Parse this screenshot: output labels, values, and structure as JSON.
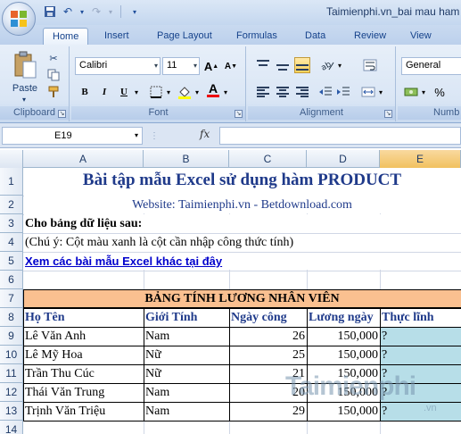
{
  "window": {
    "title": "Taimienphi.vn_bai mau ham"
  },
  "tabs": [
    "Home",
    "Insert",
    "Page Layout",
    "Formulas",
    "Data",
    "Review",
    "View"
  ],
  "ribbon": {
    "clipboard": {
      "paste_label": "Paste",
      "group_label": "Clipboard"
    },
    "font": {
      "font_name": "Calibri",
      "font_size": "11",
      "bold": "B",
      "italic": "I",
      "underline": "U",
      "grow": "A",
      "shrink": "A",
      "fill_letter": "A",
      "group_label": "Font"
    },
    "alignment": {
      "group_label": "Alignment"
    },
    "number": {
      "format": "General",
      "percent": "%",
      "group_label": "Numb"
    }
  },
  "formula_bar": {
    "name_box": "E19",
    "fx": "fx",
    "value": ""
  },
  "columns": [
    "A",
    "B",
    "C",
    "D",
    "E"
  ],
  "rows": [
    "1",
    "2",
    "3",
    "4",
    "5",
    "6",
    "7",
    "8",
    "9",
    "10",
    "11",
    "12",
    "13",
    "14"
  ],
  "sheet": {
    "title": "Bài tập mẫu Excel sử dụng hàm PRODUCT",
    "website": "Website: Taimienphi.vn - Betdownload.com",
    "intro": "Cho bảng dữ liệu sau:",
    "note": "(Chú ý: Cột màu xanh là cột cần nhập công thức tính)",
    "link": "Xem các bài mẫu Excel khác tại đây",
    "table_title": "BẢNG TÍNH LƯƠNG NHÂN VIÊN",
    "headers": [
      "Họ Tên",
      "Giới Tính",
      "Ngày công",
      "Lương ngày",
      "Thực lĩnh"
    ],
    "data": [
      [
        "Lê Văn Anh",
        "Nam",
        "26",
        "150,000",
        "?"
      ],
      [
        "Lê Mỹ Hoa",
        "Nữ",
        "25",
        "150,000",
        "?"
      ],
      [
        "Trần Thu Cúc",
        "Nữ",
        "21",
        "150,000",
        "?"
      ],
      [
        "Thái Văn Trung",
        "Nam",
        "20",
        "150,000",
        "?"
      ],
      [
        "Trịnh Văn Triệu",
        "Nam",
        "29",
        "150,000",
        "?"
      ]
    ]
  },
  "watermark": {
    "main": "Taimienphi",
    "sub": ".vn"
  },
  "colors": {
    "header_band": "#fac090",
    "formula_column": "#b7dee8",
    "title_text": "#1f3a8a",
    "link": "#0000cc"
  }
}
